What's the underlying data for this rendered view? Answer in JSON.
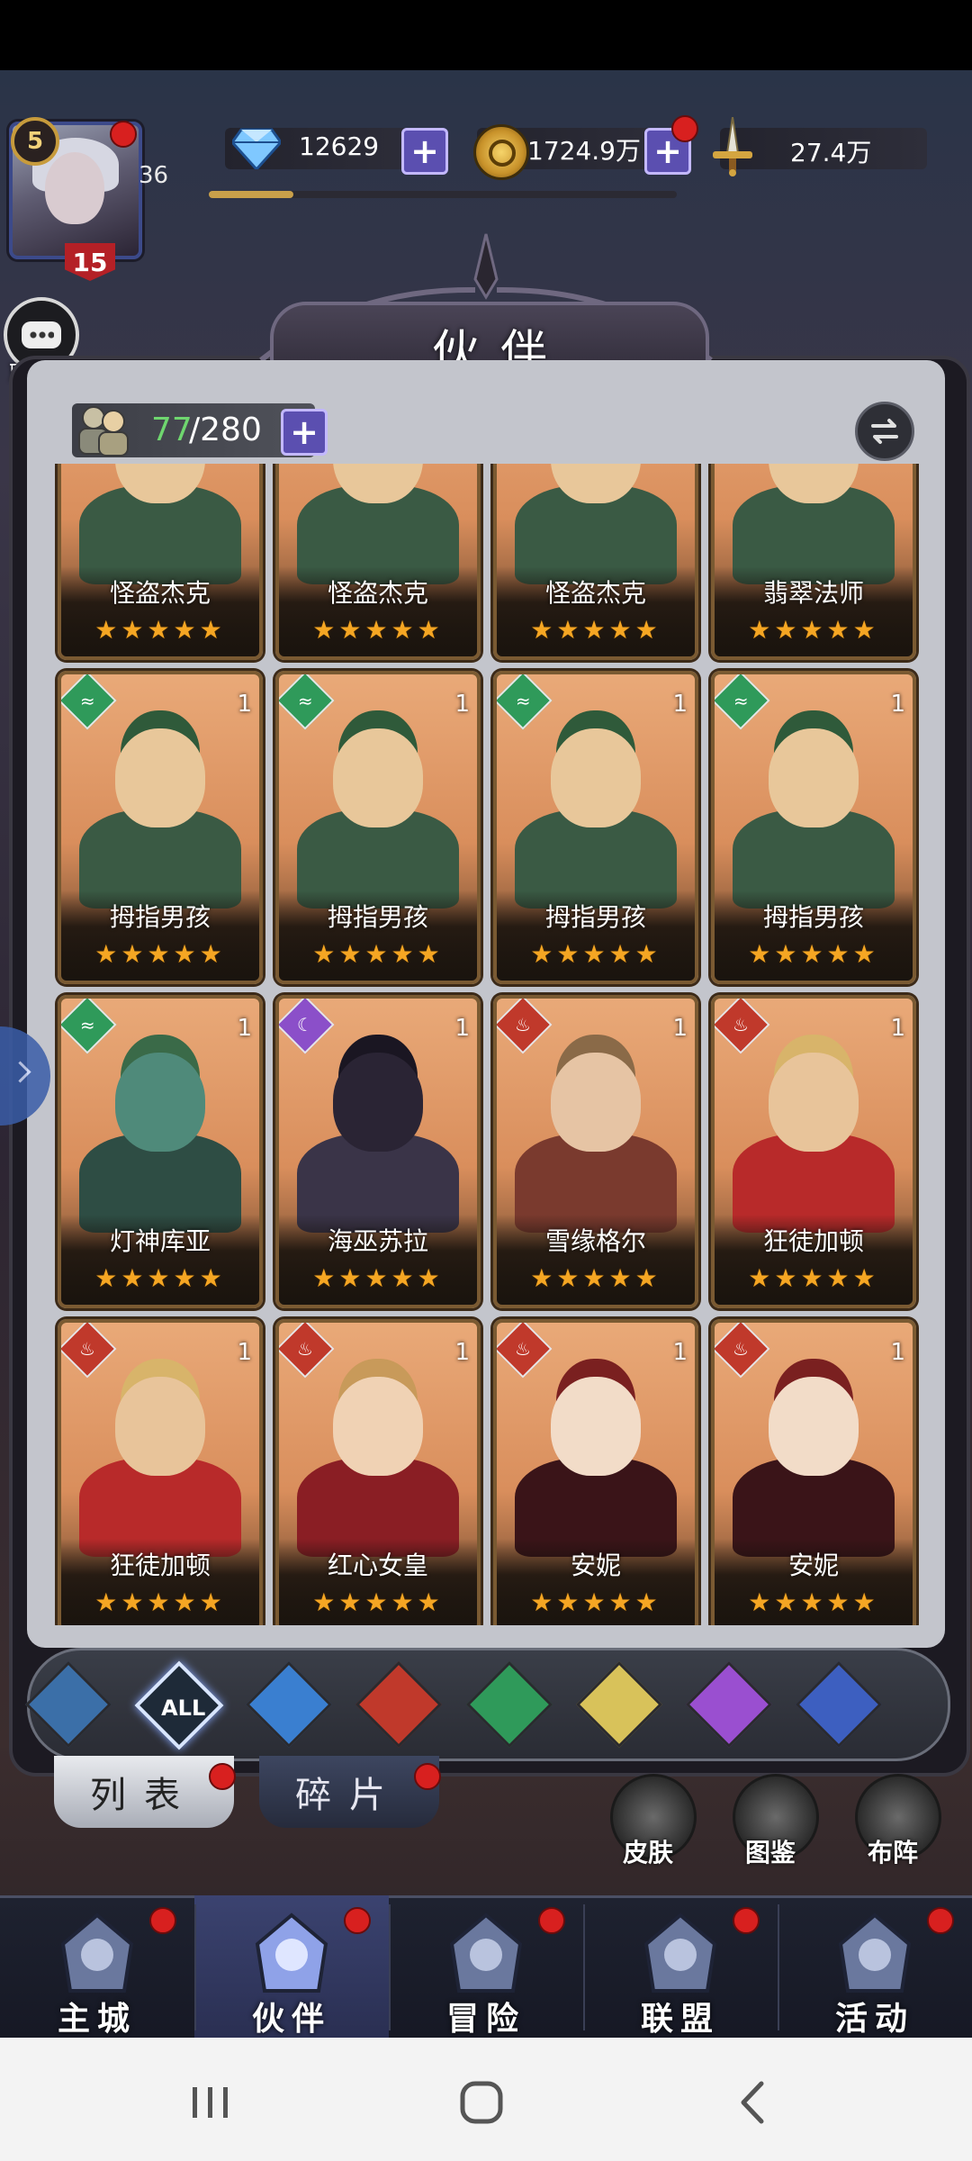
{
  "player": {
    "level": "5",
    "stamina": "36",
    "vip": "15"
  },
  "resources": {
    "gems": "12629",
    "gold": "1724.9万",
    "power": "27.4万",
    "exp_fraction": 0.18
  },
  "chat": {
    "label": "聊天"
  },
  "page_title": "伙伴",
  "roster": {
    "owned": "77",
    "total": "/280"
  },
  "cards": [
    {
      "name": "怪盗杰克",
      "stars": "★★★★★",
      "level": "",
      "element": "",
      "elem_color": "",
      "palette": "green"
    },
    {
      "name": "怪盗杰克",
      "stars": "★★★★★",
      "level": "",
      "element": "",
      "elem_color": "",
      "palette": "green"
    },
    {
      "name": "怪盗杰克",
      "stars": "★★★★★",
      "level": "",
      "element": "",
      "elem_color": "",
      "palette": "green"
    },
    {
      "name": "翡翠法师",
      "stars": "★★★★★",
      "level": "",
      "element": "",
      "elem_color": "",
      "palette": "green"
    },
    {
      "name": "拇指男孩",
      "stars": "★★★★★",
      "level": "1",
      "element": "wind-icon",
      "elem_color": "#2f9a5a",
      "palette": "green"
    },
    {
      "name": "拇指男孩",
      "stars": "★★★★★",
      "level": "1",
      "element": "wind-icon",
      "elem_color": "#2f9a5a",
      "palette": "green"
    },
    {
      "name": "拇指男孩",
      "stars": "★★★★★",
      "level": "1",
      "element": "wind-icon",
      "elem_color": "#2f9a5a",
      "palette": "green"
    },
    {
      "name": "拇指男孩",
      "stars": "★★★★★",
      "level": "1",
      "element": "wind-icon",
      "elem_color": "#2f9a5a",
      "palette": "green"
    },
    {
      "name": "灯神库亚",
      "stars": "★★★★★",
      "level": "1",
      "element": "wind-icon",
      "elem_color": "#2f9a5a",
      "palette": "teal"
    },
    {
      "name": "海巫苏拉",
      "stars": "★★★★★",
      "level": "1",
      "element": "moon-icon",
      "elem_color": "#8b4fc9",
      "palette": "dark"
    },
    {
      "name": "雪缘格尔",
      "stars": "★★★★★",
      "level": "1",
      "element": "fire-icon",
      "elem_color": "#c0392b",
      "palette": "brown"
    },
    {
      "name": "狂徒加顿",
      "stars": "★★★★★",
      "level": "1",
      "element": "fire-icon",
      "elem_color": "#c0392b",
      "palette": "red"
    },
    {
      "name": "狂徒加顿",
      "stars": "★★★★★",
      "level": "1",
      "element": "fire-icon",
      "elem_color": "#c0392b",
      "palette": "red"
    },
    {
      "name": "红心女皇",
      "stars": "★★★★★",
      "level": "1",
      "element": "fire-icon",
      "elem_color": "#c0392b",
      "palette": "crimson"
    },
    {
      "name": "安妮",
      "stars": "★★★★★",
      "level": "1",
      "element": "fire-icon",
      "elem_color": "#c0392b",
      "palette": "hood"
    },
    {
      "name": "安妮",
      "stars": "★★★★★",
      "level": "1",
      "element": "fire-icon",
      "elem_color": "#c0392b",
      "palette": "hood"
    }
  ],
  "filters": [
    {
      "name": "filter-all-elements",
      "label": "",
      "color": "#3b6fa8",
      "selected": false
    },
    {
      "name": "filter-all",
      "label": "ALL",
      "color": "#1e2a38",
      "selected": true
    },
    {
      "name": "filter-water",
      "label": "",
      "color": "#3a7fd0",
      "selected": false
    },
    {
      "name": "filter-fire",
      "label": "",
      "color": "#c0392b",
      "selected": false
    },
    {
      "name": "filter-wind",
      "label": "",
      "color": "#2f9a5a",
      "selected": false
    },
    {
      "name": "filter-light",
      "label": "",
      "color": "#d8c25a",
      "selected": false
    },
    {
      "name": "filter-dark",
      "label": "",
      "color": "#9a4fd0",
      "selected": false
    },
    {
      "name": "filter-star",
      "label": "",
      "color": "#3d5fc0",
      "selected": false
    }
  ],
  "sub_tabs": {
    "list": "列表",
    "fragments": "碎片"
  },
  "side_buttons": {
    "skin": "皮肤",
    "codex": "图鉴",
    "formation": "布阵"
  },
  "nav": [
    {
      "label": "主城",
      "active": false
    },
    {
      "label": "伙伴",
      "active": true
    },
    {
      "label": "冒险",
      "active": false
    },
    {
      "label": "联盟",
      "active": false
    },
    {
      "label": "活动",
      "active": false
    }
  ]
}
